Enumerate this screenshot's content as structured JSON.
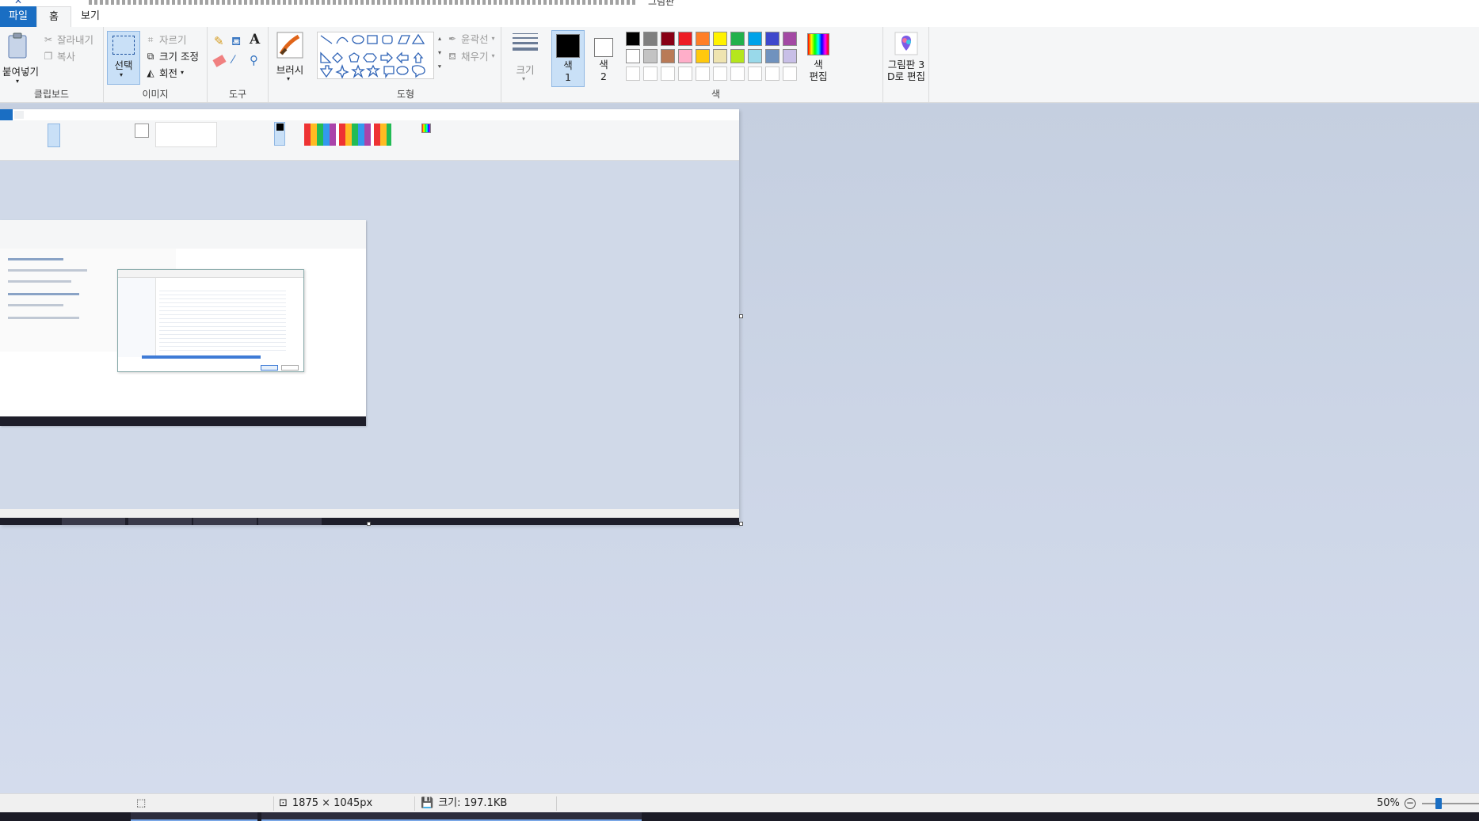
{
  "window": {
    "title": "그림판",
    "quick_access": "✕"
  },
  "tabs": [
    {
      "label": "파일"
    },
    {
      "label": "홈"
    },
    {
      "label": "보기"
    }
  ],
  "ribbon": {
    "clipboard": {
      "label": "클립보드",
      "paste": "붙여넣기",
      "cut": "잘라내기",
      "copy": "복사"
    },
    "image": {
      "label": "이미지",
      "select": "선택",
      "crop": "자르기",
      "resize": "크기 조정",
      "rotate": "회전"
    },
    "tools": {
      "label": "도구",
      "text_glyph": "A"
    },
    "brushes": {
      "label": "브러시"
    },
    "shapes": {
      "label": "도형",
      "outline": "윤곽선",
      "fill": "채우기"
    },
    "size": {
      "label": "크기"
    },
    "colors": {
      "label": "색",
      "color1": "색\n1",
      "color2": "색\n2",
      "edit_colors": "색\n편집",
      "paint3d": "그림판 3\nD로 편집",
      "palette_row1": [
        "#000000",
        "#7f7f7f",
        "#880015",
        "#ed1c24",
        "#ff7f27",
        "#fff200",
        "#22b14c",
        "#00a2e8",
        "#3f48cc",
        "#a349a4"
      ],
      "palette_row2": [
        "#ffffff",
        "#c3c3c3",
        "#b97a57",
        "#ffaec9",
        "#ffc90e",
        "#efe4b0",
        "#b5e61d",
        "#99d9ea",
        "#7092be",
        "#c8bfe7"
      ]
    }
  },
  "statusbar": {
    "canvas_size": "1875 × 1045px",
    "file_size": "크기: 197.1KB",
    "zoom": "50%"
  }
}
